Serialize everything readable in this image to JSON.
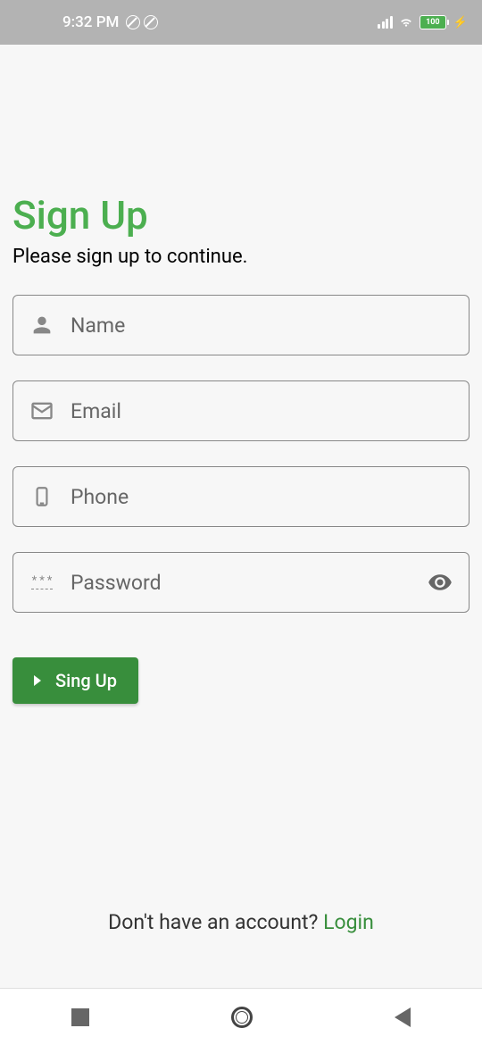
{
  "statusBar": {
    "time": "9:32 PM",
    "batteryLevel": "100"
  },
  "page": {
    "title": "Sign Up",
    "subtitle": "Please sign up to continue."
  },
  "fields": {
    "name": {
      "placeholder": "Name"
    },
    "email": {
      "placeholder": "Email"
    },
    "phone": {
      "placeholder": "Phone"
    },
    "password": {
      "placeholder": "Password"
    }
  },
  "button": {
    "signup": "Sing Up"
  },
  "footer": {
    "prompt": "Don't have an account? ",
    "loginLink": "Login"
  }
}
